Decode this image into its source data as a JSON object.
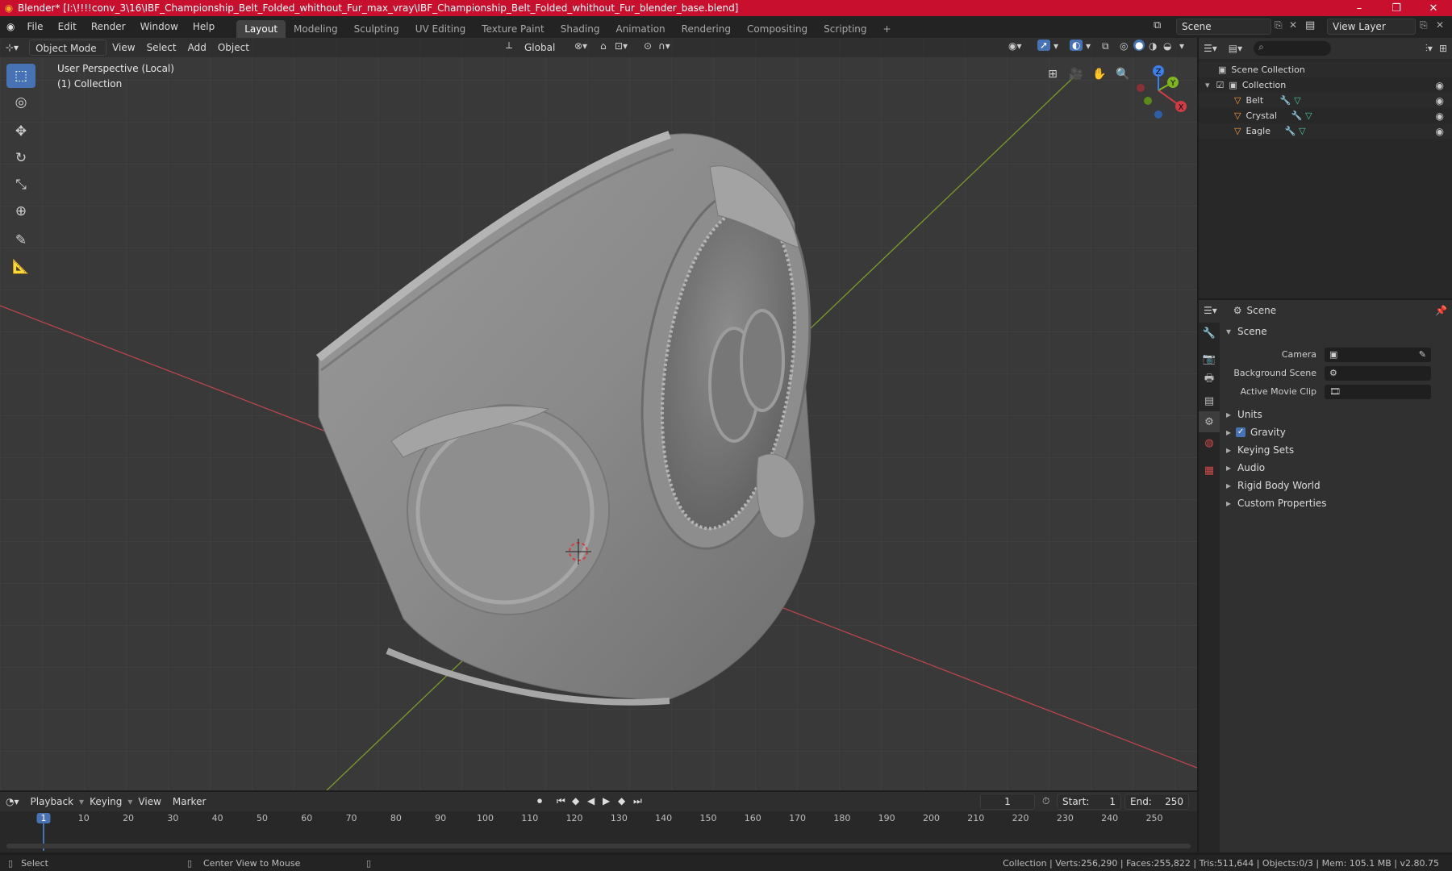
{
  "window": {
    "title": "Blender* [I:\\!!!!conv_3\\16\\IBF_Championship_Belt_Folded_whithout_Fur_max_vray\\IBF_Championship_Belt_Folded_whithout_Fur_blender_base.blend]",
    "minimize": "–",
    "maximize": "❐",
    "close": "✕"
  },
  "menus": [
    "File",
    "Edit",
    "Render",
    "Window",
    "Help"
  ],
  "workspaces": {
    "tabs": [
      "Layout",
      "Modeling",
      "Sculpting",
      "UV Editing",
      "Texture Paint",
      "Shading",
      "Animation",
      "Rendering",
      "Compositing",
      "Scripting"
    ],
    "active": "Layout",
    "add": "+"
  },
  "scene_selector": "Scene",
  "view_layer": "View Layer",
  "viewport": {
    "mode": "Object Mode",
    "menus": [
      "View",
      "Select",
      "Add",
      "Object"
    ],
    "orientation": "Global",
    "perspective_label": "User Perspective (Local)",
    "collection_label": "(1) Collection",
    "gizmo_axes": [
      "X",
      "Y",
      "Z"
    ]
  },
  "outliner": {
    "root": "Scene Collection",
    "collection": "Collection",
    "objects": [
      "Belt",
      "Crystal",
      "Eagle"
    ]
  },
  "properties": {
    "header": "Scene",
    "panel_title": "Scene",
    "fields": [
      {
        "label": "Camera",
        "value": ""
      },
      {
        "label": "Background Scene",
        "value": ""
      },
      {
        "label": "Active Movie Clip",
        "value": ""
      }
    ],
    "sections": [
      "Units",
      "Gravity",
      "Keying Sets",
      "Audio",
      "Rigid Body World",
      "Custom Properties"
    ],
    "gravity_checked": true
  },
  "timeline": {
    "menus": [
      "Playback",
      "Keying",
      "View",
      "Marker"
    ],
    "current_frame": "1",
    "start_label": "Start:",
    "start": "1",
    "end_label": "End:",
    "end": "250",
    "ticks": [
      "1",
      "10",
      "20",
      "30",
      "40",
      "50",
      "60",
      "70",
      "80",
      "90",
      "100",
      "110",
      "120",
      "130",
      "140",
      "150",
      "160",
      "170",
      "180",
      "190",
      "200",
      "210",
      "220",
      "230",
      "240",
      "250"
    ]
  },
  "statusbar": {
    "left": "Select",
    "middle": "Center View to Mouse",
    "right": "Collection | Verts:256,290 | Faces:255,822 | Tris:511,644 | Objects:0/3 | Mem: 105.1 MB | v2.80.75"
  },
  "colors": {
    "title_bar": "#c8102e",
    "accent": "#4772b3",
    "axis_x": "#d03b46",
    "axis_y": "#7fb51b",
    "axis_z": "#3a7ee6"
  }
}
